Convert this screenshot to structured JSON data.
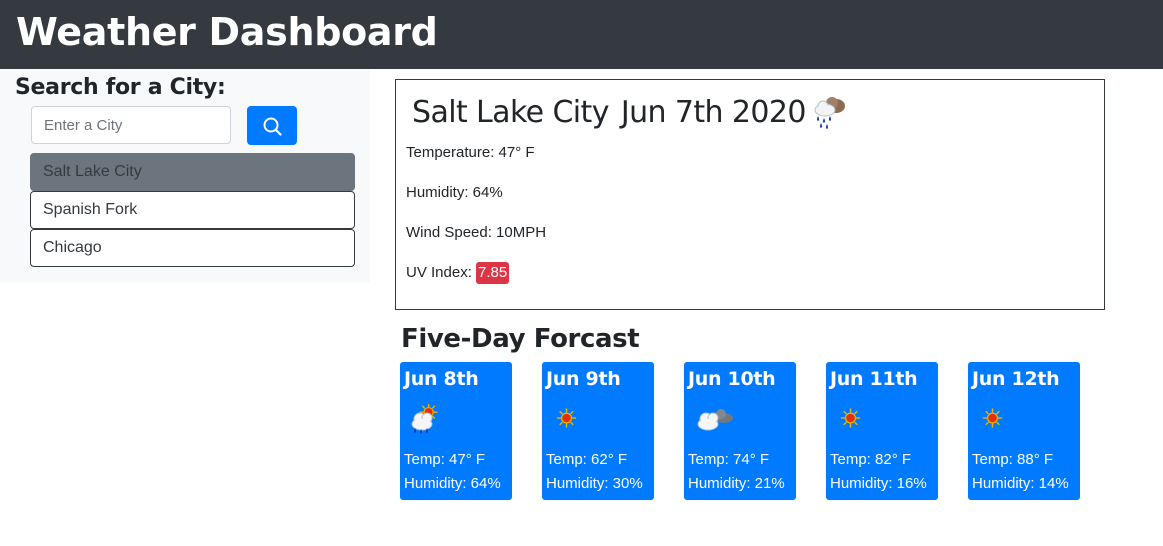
{
  "header": {
    "title": "Weather Dashboard"
  },
  "search": {
    "heading": "Search for a City:",
    "placeholder": "Enter a City",
    "button_icon": "search-icon"
  },
  "history": [
    {
      "label": "Salt Lake City",
      "active": true
    },
    {
      "label": "Spanish Fork",
      "active": false
    },
    {
      "label": "Chicago",
      "active": false
    }
  ],
  "current": {
    "city": "Salt Lake City",
    "date": "Jun 7th 2020",
    "icon": "rain-icon",
    "temperature": "Temperature: 47° F",
    "humidity": "Humidity: 64%",
    "wind": "Wind Speed: 10MPH",
    "uv_label": "UV Index:",
    "uv_value": "7.85",
    "uv_color": "#dc3545"
  },
  "forecast": {
    "heading": "Five-Day Forcast",
    "days": [
      {
        "date": "Jun 8th",
        "icon": "sun-rain-icon",
        "temp": "Temp: 47° F",
        "humidity": "Humidity: 64%"
      },
      {
        "date": "Jun 9th",
        "icon": "sun-icon",
        "temp": "Temp: 62° F",
        "humidity": "Humidity: 30%"
      },
      {
        "date": "Jun 10th",
        "icon": "cloud-icon",
        "temp": "Temp: 74° F",
        "humidity": "Humidity: 21%"
      },
      {
        "date": "Jun 11th",
        "icon": "sun-icon",
        "temp": "Temp: 82° F",
        "humidity": "Humidity: 16%"
      },
      {
        "date": "Jun 12th",
        "icon": "sun-icon",
        "temp": "Temp: 88° F",
        "humidity": "Humidity: 14%"
      }
    ]
  },
  "colors": {
    "navbar": "#343a40",
    "primary": "#007bff",
    "active_city": "#6c757d",
    "uv_high": "#dc3545"
  }
}
